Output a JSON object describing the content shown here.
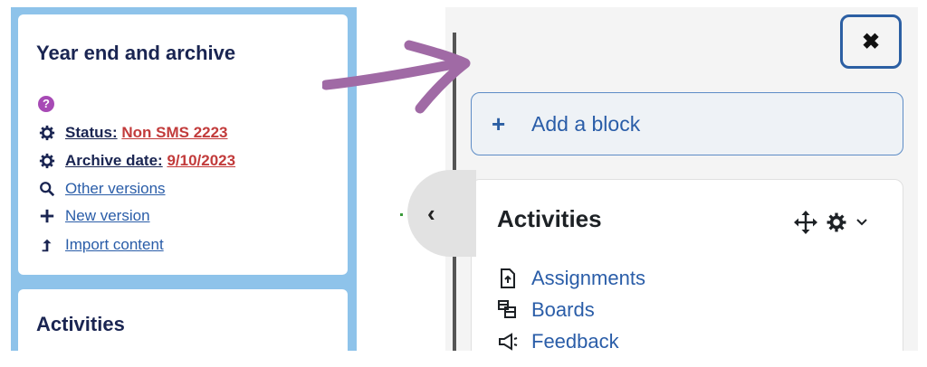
{
  "left": {
    "year_end_card": {
      "title": "Year end and archive",
      "help_icon": "?",
      "links": [
        {
          "icon": "gear-icon",
          "label": "Status:",
          "value": "Non SMS 2223"
        },
        {
          "icon": "gear-icon",
          "label": "Archive date:",
          "value": "9/10/2023"
        },
        {
          "icon": "search-icon",
          "label": "Other versions"
        },
        {
          "icon": "plus-icon",
          "label": "New version"
        },
        {
          "icon": "upload-arrow-icon",
          "label": "Import content"
        }
      ]
    },
    "activities_card": {
      "title": "Activities"
    }
  },
  "right": {
    "close_button": "✖",
    "add_block": {
      "icon": "+",
      "label": "Add a block"
    },
    "activities_block": {
      "title": "Activities",
      "items": [
        {
          "icon": "assignment-icon",
          "label": "Assignments"
        },
        {
          "icon": "boards-icon",
          "label": "Boards"
        },
        {
          "icon": "megaphone-icon",
          "label": "Feedback"
        }
      ]
    },
    "collapse_tab_glyph": "‹"
  },
  "colors": {
    "accent_blue": "#2c5fa3",
    "link_blue": "#2a5da8",
    "navy": "#1a2552",
    "red_value": "#c23b3b",
    "arrow_purple": "#a06aa5",
    "left_bg": "#8ec3ea"
  }
}
